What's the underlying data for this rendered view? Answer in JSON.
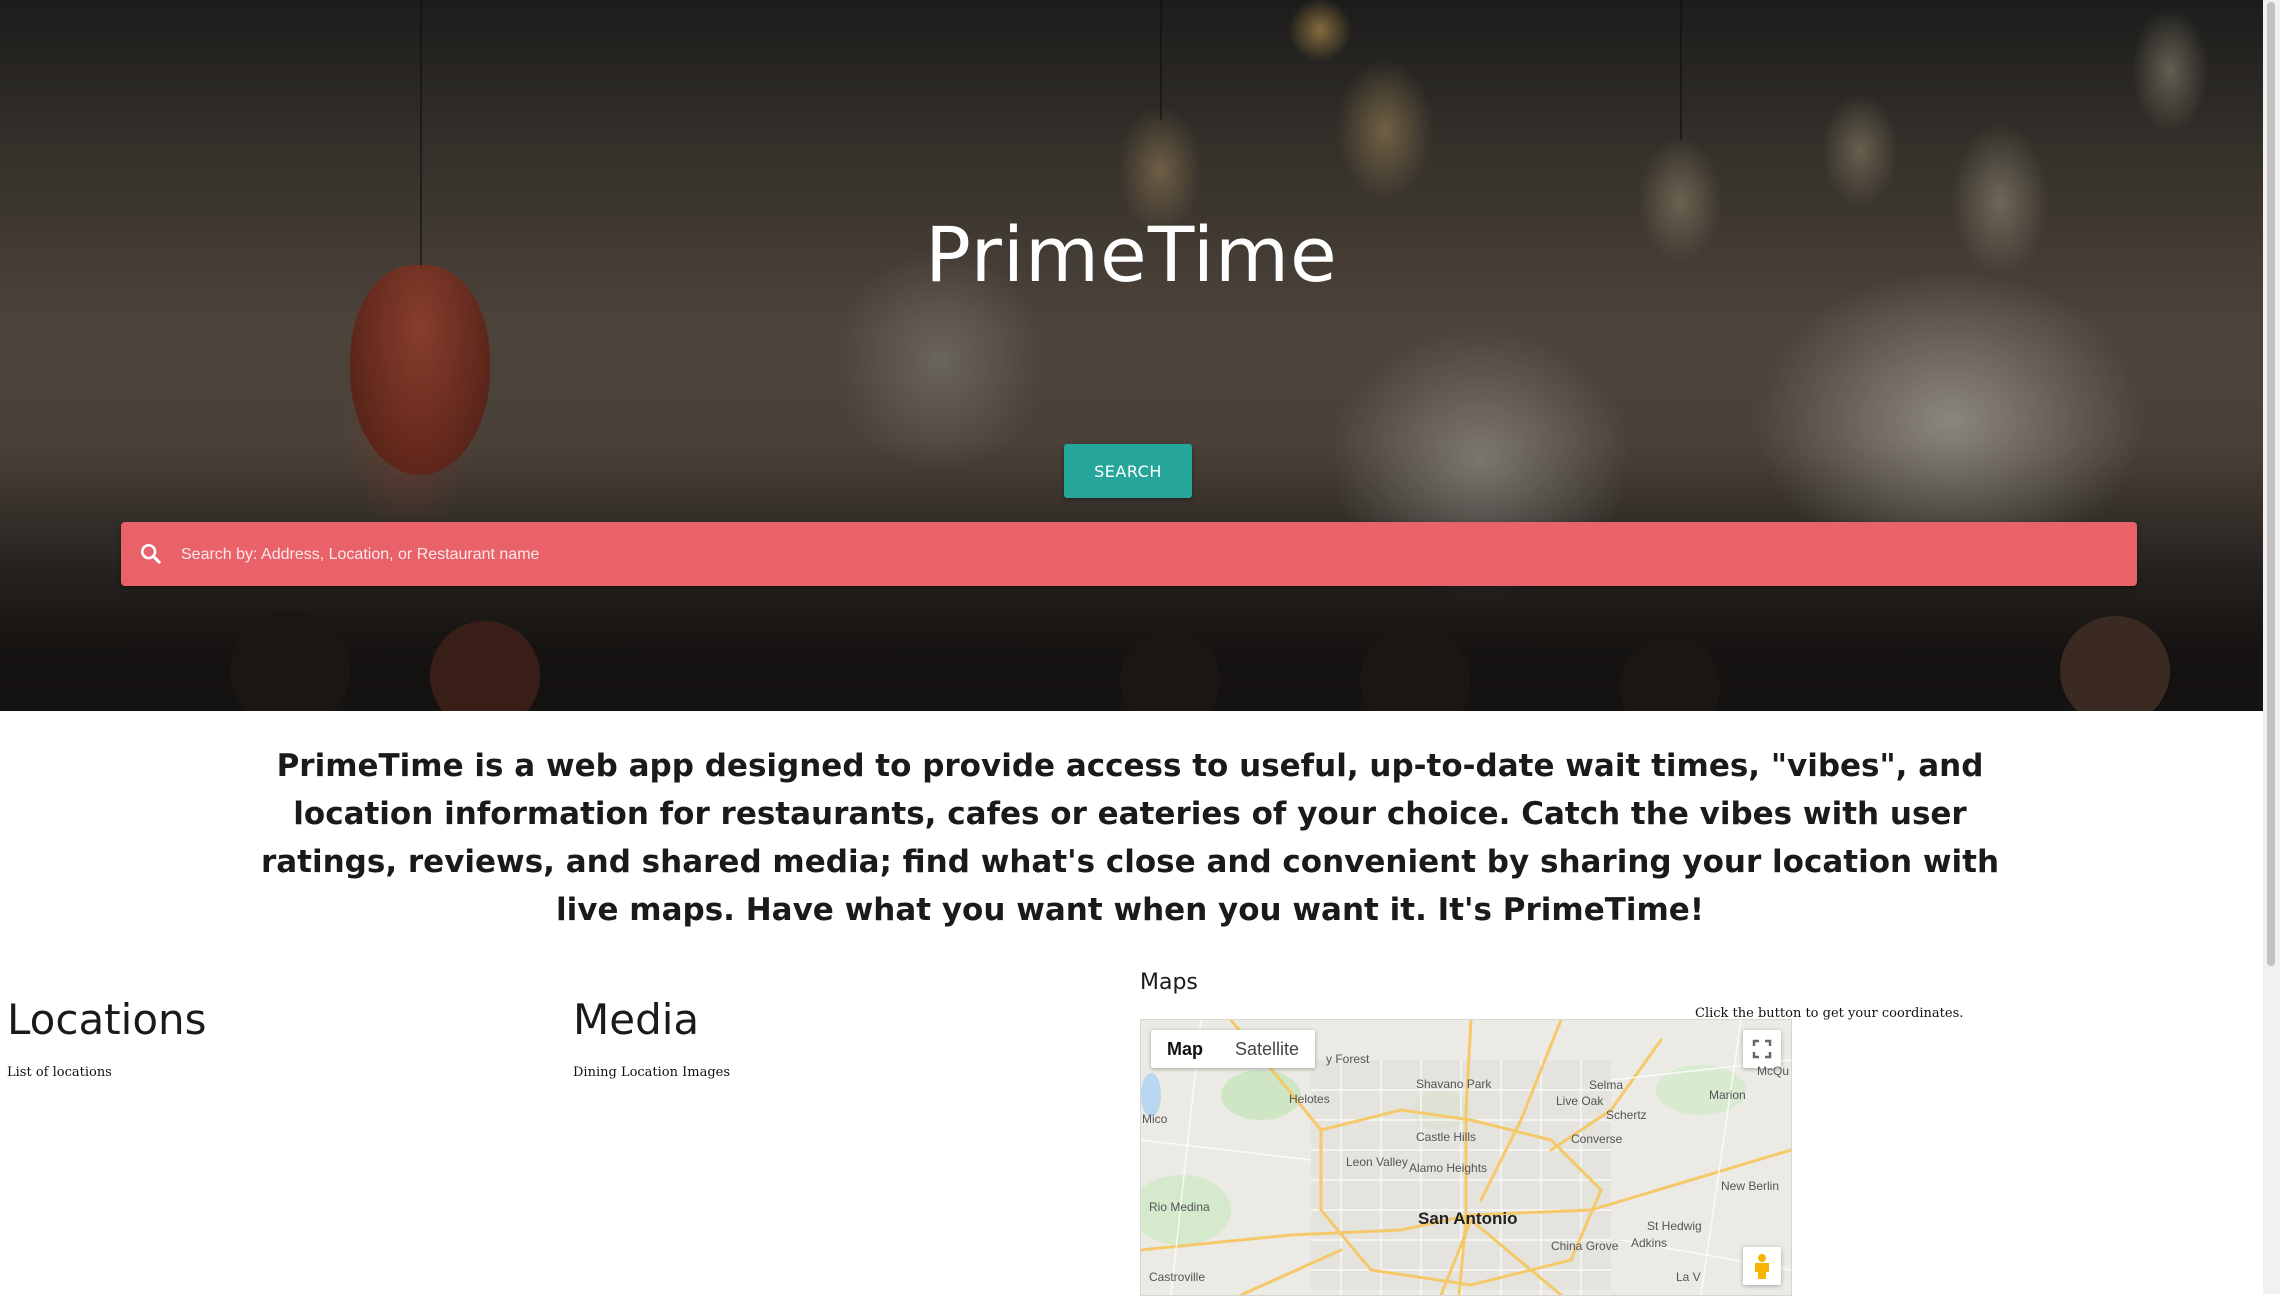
{
  "hero": {
    "title": "PrimeTime",
    "search_button_label": "SEARCH",
    "search_placeholder": "Search by: Address, Location, or Restaurant name",
    "search_bar_color": "#e9626a",
    "button_color": "#26a69a"
  },
  "intro": {
    "text": "PrimeTime is a web app designed to provide access to useful, up-to-date wait times, \"vibes\", and location information for restaurants, cafes or eateries of your choice. Catch the vibes with user ratings, reviews, and shared media; find what's close and convenient by sharing your location with live maps. Have what you want when you want it. It's PrimeTime!"
  },
  "locations": {
    "title": "Locations",
    "subtitle": "List of locations"
  },
  "media": {
    "title": "Media",
    "subtitle": "Dining Location Images"
  },
  "maps": {
    "title": "Maps",
    "note": "Click the button to get your coordinates.",
    "map_type_options": [
      "Map",
      "Satellite"
    ],
    "selected_map_type": "Map",
    "icons": [
      "fullscreen-icon",
      "pegman-icon"
    ],
    "places": {
      "san_antonio": "San Antonio",
      "shavano_park": "Shavano Park",
      "selma": "Selma",
      "marion": "Marion",
      "live_oak": "Live Oak",
      "schertz": "Schertz",
      "helotes": "Helotes",
      "castle_hills": "Castle Hills",
      "converse": "Converse",
      "leon_valley": "Leon Valley",
      "alamo_heights": "Alamo Heights",
      "rio_medina": "Rio Medina",
      "new_berlin": "New Berlin",
      "st_hedwig": "St Hedwig",
      "china_grove": "China Grove",
      "adkins": "Adkins",
      "castroville": "Castroville",
      "forest": "y Forest",
      "mico": "Mico",
      "mcqu": "McQu",
      "la_v": "La V"
    }
  }
}
